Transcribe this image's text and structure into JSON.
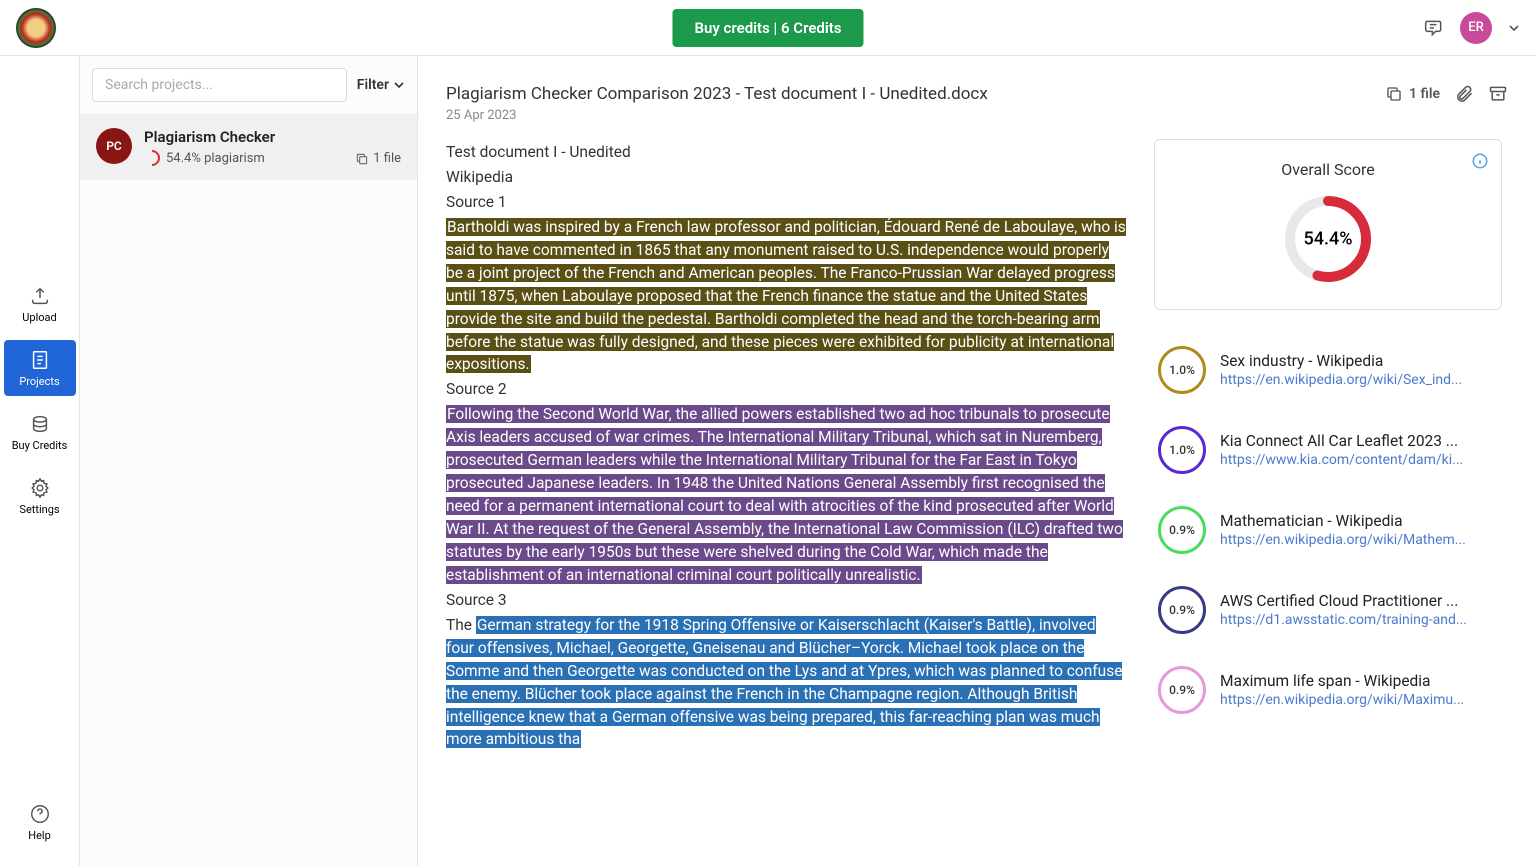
{
  "header": {
    "buy_credits": "Buy credits | 6 Credits",
    "avatar_initials": "ER"
  },
  "nav": {
    "upload": "Upload",
    "projects": "Projects",
    "buy_credits": "Buy Credits",
    "settings": "Settings",
    "help": "Help"
  },
  "sidebar": {
    "search_placeholder": "Search projects...",
    "filter": "Filter",
    "project": {
      "initials": "PC",
      "title": "Plagiarism Checker",
      "plagiarism": "54.4% plagiarism",
      "files": "1 file"
    }
  },
  "doc": {
    "title": "Plagiarism Checker Comparison 2023 - Test document I - Unedited.docx",
    "date": "25 Apr 2023",
    "file_count": "1 file",
    "line_test": "Test document I - Unedited",
    "line_wiki": "Wikipedia",
    "src1": "Source 1",
    "para1": "Bartholdi was inspired by a French law professor and politician, Édouard René de Laboulaye, who is said to have commented in 1865 that any monument raised to U.S. independence would properly be a joint project of the French and American peoples. The Franco-Prussian War delayed progress until 1875, when Laboulaye proposed that the French finance the statue and the United States provide the site and build the pedestal. Bartholdi completed the head and the torch-bearing arm before the statue was fully designed, and these pieces were exhibited for publicity at international expositions.",
    "src2": "Source 2",
    "para2": "Following the Second World War, the allied powers established two ad hoc tribunals to prosecute Axis leaders accused of war crimes. The International Military Tribunal, which sat in Nuremberg, prosecuted German leaders while the International Military Tribunal for the Far East in Tokyo prosecuted Japanese leaders. In 1948 the United Nations General Assembly first recognised the need for a permanent international court to deal with atrocities of the kind prosecuted after World War II. At the request of the General Assembly, the International Law Commission (ILC) drafted two statutes by the early 1950s but these were shelved during the Cold War, which made the establishment of an international criminal court politically unrealistic.",
    "src3": "Source 3",
    "para3_prefix": "The ",
    "para3": "German strategy for the 1918 Spring Offensive or Kaiserschlacht (Kaiser's Battle), involved four offensives, Michael, Georgette, Gneisenau and Blücher–Yorck. Michael took place on the Somme and then Georgette was conducted on the Lys and at Ypres, which was planned to confuse the enemy. Blücher took place against the French in the Champagne region. Although British intelligence knew that a German offensive was being prepared, this far-reaching plan was much more ambitious tha"
  },
  "score": {
    "title": "Overall Score",
    "pct": "54.4%",
    "pct_value": 54.4
  },
  "sources": [
    {
      "pct": "1.0%",
      "color": "#b08a1a",
      "title": "Sex industry - Wikipedia",
      "url": "https://en.wikipedia.org/wiki/Sex_ind..."
    },
    {
      "pct": "1.0%",
      "color": "#5a2ad0",
      "title": "Kia Connect All Car Leaflet 2023 ...",
      "url": "https://www.kia.com/content/dam/ki..."
    },
    {
      "pct": "0.9%",
      "color": "#4adc5a",
      "title": "Mathematician - Wikipedia",
      "url": "https://en.wikipedia.org/wiki/Mathem..."
    },
    {
      "pct": "0.9%",
      "color": "#3a3a8a",
      "title": "AWS Certified Cloud Practitioner ...",
      "url": "https://d1.awsstatic.com/training-and..."
    },
    {
      "pct": "0.9%",
      "color": "#e59adc",
      "title": "Maximum life span - Wikipedia",
      "url": "https://en.wikipedia.org/wiki/Maximu..."
    }
  ]
}
